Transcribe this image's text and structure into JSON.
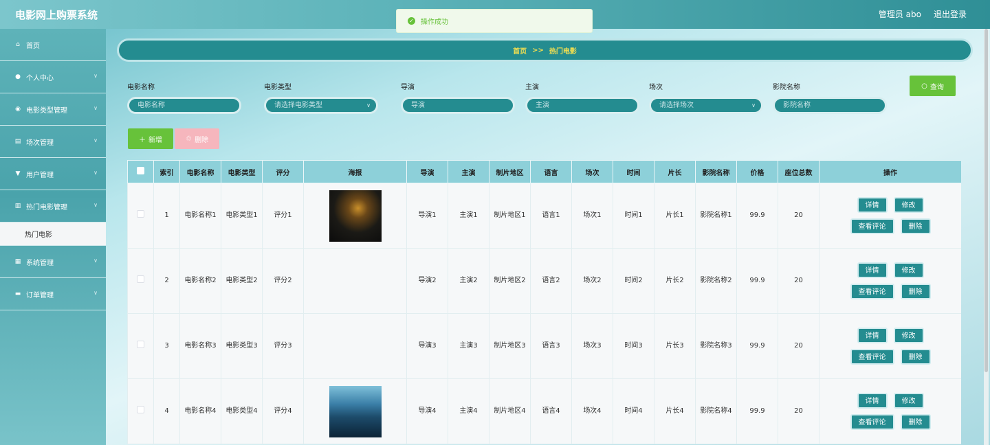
{
  "header": {
    "title": "电影网上购票系统",
    "user": "管理员 abo",
    "logout": "退出登录"
  },
  "toast": {
    "message": "操作成功"
  },
  "sidebar": {
    "items": [
      {
        "label": "首页",
        "icon": "home-icon",
        "glyph": "⌂",
        "chevron": false
      },
      {
        "label": "个人中心",
        "icon": "user-icon",
        "glyph": "●",
        "chevron": true
      },
      {
        "label": "电影类型管理",
        "icon": "location-icon",
        "glyph": "◉",
        "chevron": true
      },
      {
        "label": "场次管理",
        "icon": "clipboard-icon",
        "glyph": "▤",
        "chevron": true
      },
      {
        "label": "用户管理",
        "icon": "user-manage-icon",
        "glyph": "▼",
        "chevron": true
      },
      {
        "label": "热门电影管理",
        "icon": "chart-icon",
        "glyph": "▥",
        "chevron": true
      }
    ],
    "submenu": {
      "label": "热门电影"
    },
    "items_after": [
      {
        "label": "系统管理",
        "icon": "grid-icon",
        "glyph": "▦",
        "chevron": true
      },
      {
        "label": "订单管理",
        "icon": "order-icon",
        "glyph": "▬",
        "chevron": true
      }
    ]
  },
  "breadcrumb": {
    "home": "首页",
    "sep": ">>",
    "current": "热门电影"
  },
  "search": {
    "fields": [
      {
        "label": "电影名称",
        "placeholder": "电影名称",
        "dropdown": false
      },
      {
        "label": "电影类型",
        "placeholder": "请选择电影类型",
        "dropdown": true
      },
      {
        "label": "导演",
        "placeholder": "导演",
        "dropdown": false
      },
      {
        "label": "主演",
        "placeholder": "主演",
        "dropdown": false
      },
      {
        "label": "场次",
        "placeholder": "请选择场次",
        "dropdown": true
      },
      {
        "label": "影院名称",
        "placeholder": "影院名称",
        "dropdown": false
      }
    ],
    "query_label": "查询"
  },
  "actions": {
    "add_label": "新增",
    "delete_label": "删除"
  },
  "table": {
    "columns": [
      "索引",
      "电影名称",
      "电影类型",
      "评分",
      "海报",
      "导演",
      "主演",
      "制片地区",
      "语言",
      "场次",
      "时间",
      "片长",
      "影院名称",
      "价格",
      "座位总数",
      "操作"
    ],
    "rows": [
      {
        "index": "1",
        "name": "电影名称1",
        "type": "电影类型1",
        "score": "评分1",
        "poster": "poster1",
        "director": "导演1",
        "actor": "主演1",
        "region": "制片地区1",
        "language": "语言1",
        "session": "场次1",
        "time": "时间1",
        "length": "片长1",
        "cinema": "影院名称1",
        "price": "99.9",
        "seats": "20"
      },
      {
        "index": "2",
        "name": "电影名称2",
        "type": "电影类型2",
        "score": "评分2",
        "poster": "",
        "director": "导演2",
        "actor": "主演2",
        "region": "制片地区2",
        "language": "语言2",
        "session": "场次2",
        "time": "时间2",
        "length": "片长2",
        "cinema": "影院名称2",
        "price": "99.9",
        "seats": "20"
      },
      {
        "index": "3",
        "name": "电影名称3",
        "type": "电影类型3",
        "score": "评分3",
        "poster": "",
        "director": "导演3",
        "actor": "主演3",
        "region": "制片地区3",
        "language": "语言3",
        "session": "场次3",
        "time": "时间3",
        "length": "片长3",
        "cinema": "影院名称3",
        "price": "99.9",
        "seats": "20"
      },
      {
        "index": "4",
        "name": "电影名称4",
        "type": "电影类型4",
        "score": "评分4",
        "poster": "poster2",
        "director": "导演4",
        "actor": "主演4",
        "region": "制片地区4",
        "language": "语言4",
        "session": "场次4",
        "time": "时间4",
        "length": "片长4",
        "cinema": "影院名称4",
        "price": "99.9",
        "seats": "20"
      }
    ],
    "row_actions": [
      "详情",
      "修改",
      "查看评论",
      "删除"
    ]
  },
  "colors": {
    "accent": "#248c90",
    "success": "#67c23a",
    "danger_light": "#f6b6bd",
    "header_th": "#8dd0d9"
  }
}
